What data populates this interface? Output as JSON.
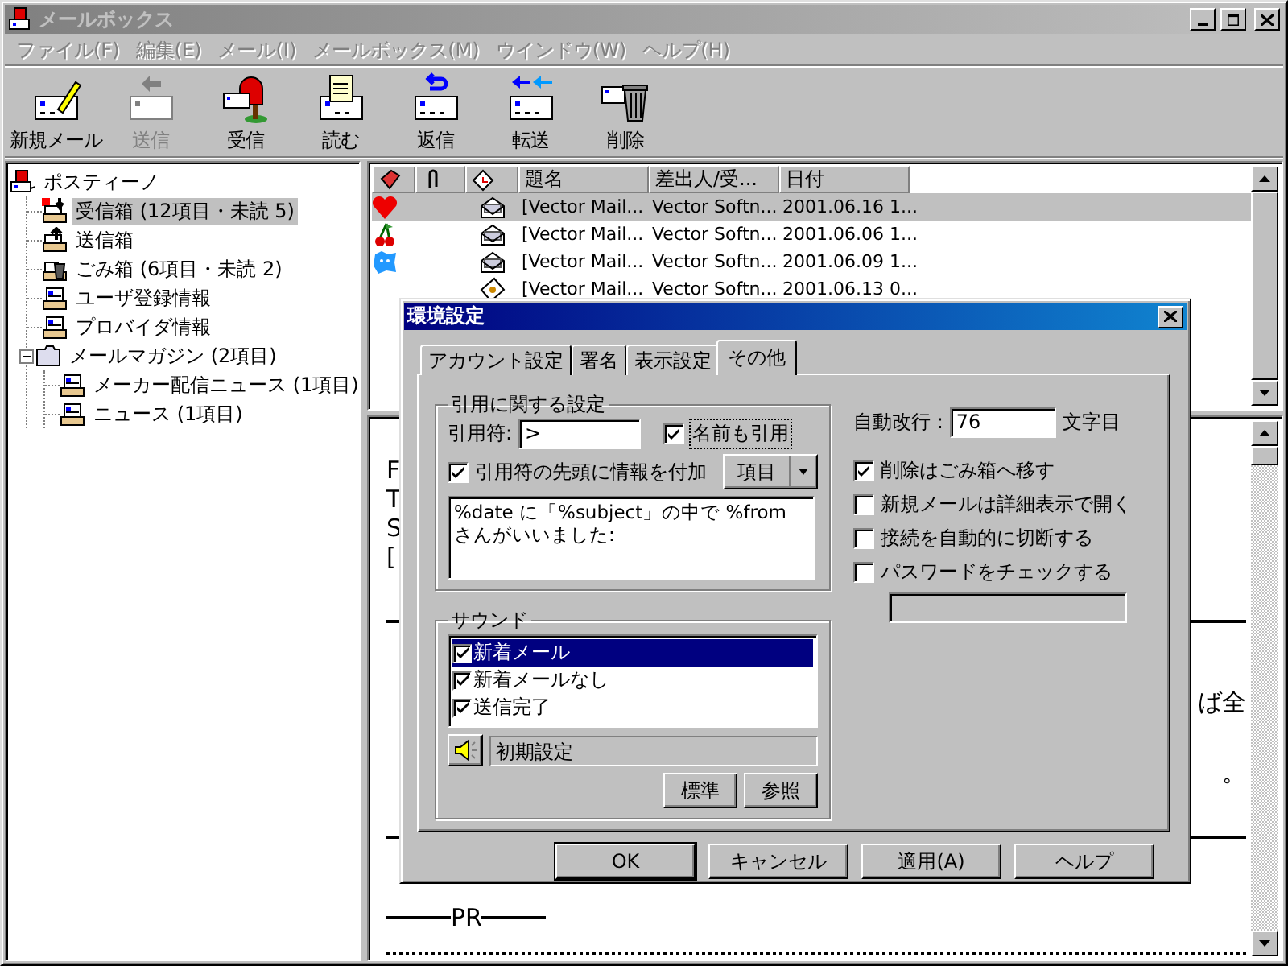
{
  "window": {
    "title": "メールボックス",
    "active": false
  },
  "menu": [
    {
      "label": "ファイル(F)",
      "disabled": true
    },
    {
      "label": "編集(E)",
      "disabled": true
    },
    {
      "label": "メール(I)",
      "disabled": true
    },
    {
      "label": "メールボックス(M)",
      "disabled": true
    },
    {
      "label": "ウインドウ(W)",
      "disabled": true
    },
    {
      "label": "ヘルプ(H)",
      "disabled": true
    }
  ],
  "toolbar": [
    {
      "label": "新規メール",
      "kind": "new",
      "disabled": false
    },
    {
      "label": "送信",
      "kind": "send",
      "disabled": true
    },
    {
      "label": "受信",
      "kind": "receive",
      "disabled": false
    },
    {
      "label": "読む",
      "kind": "read",
      "disabled": false
    },
    {
      "label": "返信",
      "kind": "reply",
      "disabled": false
    },
    {
      "label": "転送",
      "kind": "forward",
      "disabled": false
    },
    {
      "label": "削除",
      "kind": "delete",
      "disabled": false
    }
  ],
  "folders": [
    {
      "label": "ポスティーノ",
      "kind": "root",
      "selected": false,
      "children": [
        {
          "label": "受信箱 (12項目・未読 5)",
          "kind": "inbox",
          "selected": true
        },
        {
          "label": "送信箱",
          "kind": "outbox",
          "selected": false
        },
        {
          "label": "ごみ箱 (6項目・未読 2)",
          "kind": "trash",
          "selected": false
        },
        {
          "label": "ユーザ登録情報",
          "kind": "box",
          "selected": false
        },
        {
          "label": "プロバイダ情報",
          "kind": "box",
          "selected": false
        },
        {
          "label": "メールマガジン (2項目)",
          "kind": "folder",
          "selected": false,
          "expanded": true,
          "children": [
            {
              "label": "メーカー配信ニュース (1項目)",
              "kind": "box",
              "selected": false
            },
            {
              "label": "ニュース (1項目)",
              "kind": "box",
              "selected": false
            }
          ]
        }
      ]
    }
  ],
  "mail_list": {
    "columns": [
      "題名",
      "差出人/受...",
      "日付"
    ],
    "rows": [
      {
        "mark": {
          "kind": "heart"
        },
        "kind": "mail",
        "subject": "[Vector Mail...",
        "sender": "Vector Softn...",
        "date": "2001.06.16 1...",
        "selected": true
      },
      {
        "mark": {
          "kind": "cherry"
        },
        "kind": "mail",
        "subject": "[Vector Mail...",
        "sender": "Vector Softn...",
        "date": "2001.06.06 1...",
        "selected": false
      },
      {
        "mark": {
          "kind": "blob"
        },
        "kind": "mail",
        "subject": "[Vector Mail...",
        "sender": "Vector Softn...",
        "date": "2001.06.09 1...",
        "selected": false
      },
      {
        "kind": "note",
        "subject": "[Vector Mail...",
        "sender": "Vector Softn...",
        "date": "2001.06.13 0...",
        "selected": false
      }
    ]
  },
  "preview": [
    {
      "kind": "text",
      "left": "F"
    },
    {
      "kind": "text",
      "left": "T"
    },
    {
      "kind": "text",
      "left": "S"
    },
    {
      "kind": "text",
      "left": "["
    },
    {
      "kind": "rule"
    },
    {
      "kind": "text",
      "right": "ば全"
    },
    {
      "kind": "text",
      "right": "。"
    },
    {
      "kind": "rule"
    },
    {
      "kind": "pr",
      "left": "PR"
    },
    {
      "kind": "dots"
    }
  ],
  "dialog": {
    "title": "環境設定",
    "tabs": [
      {
        "label": "アカウント設定",
        "selected": false
      },
      {
        "label": "署名",
        "selected": false
      },
      {
        "label": "表示設定",
        "selected": false
      },
      {
        "label": "その他",
        "selected": true
      }
    ],
    "quote": {
      "title": "引用に関する設定",
      "mark_label": "引用符:",
      "mark_value": ">",
      "quote_name": {
        "label": "名前も引用",
        "checked": true,
        "focused": true
      },
      "add_header": {
        "label": "引用符の先頭に情報を付加",
        "checked": true,
        "focused": false
      },
      "insert_button": "項目",
      "template": "%date に「%subject」の中で %from さんがいいました:"
    },
    "wrap": {
      "label": "自動改行 :",
      "value": "76",
      "unit": "文字目"
    },
    "options": [
      {
        "label": "削除はごみ箱へ移す",
        "checked": true
      },
      {
        "label": "新規メールは詳細表示で開く",
        "checked": false
      },
      {
        "label": "接続を自動的に切断する",
        "checked": false
      },
      {
        "label": "パスワードをチェックする",
        "checked": false
      }
    ],
    "password_field": {
      "disabled": true
    },
    "sound": {
      "title": "サウンド",
      "events": [
        {
          "label": "新着メール",
          "checked": true,
          "selected": true
        },
        {
          "label": "新着メールなし",
          "checked": true,
          "selected": false
        },
        {
          "label": "送信完了",
          "checked": true,
          "selected": false
        }
      ],
      "file": {
        "value": "初期設定",
        "disabled": true
      },
      "buttons": [
        "標準",
        "参照"
      ]
    },
    "buttons": [
      {
        "label": "OK",
        "default": true
      },
      {
        "label": "キャンセル",
        "default": false
      },
      {
        "label": "適用(A)",
        "default": false
      },
      {
        "label": "ヘルプ",
        "default": false
      }
    ]
  }
}
